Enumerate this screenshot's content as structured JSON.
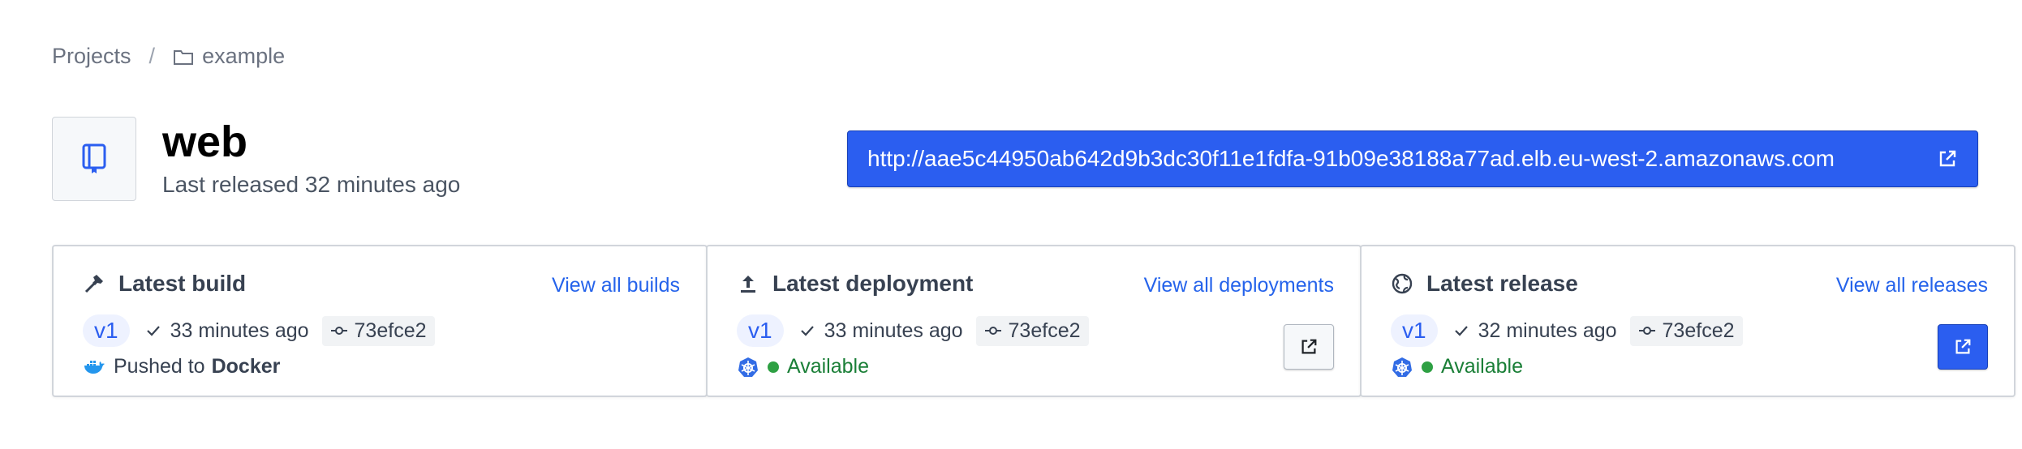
{
  "breadcrumb": {
    "root": "Projects",
    "separator": "/",
    "current": "example"
  },
  "header": {
    "title": "web",
    "subtitle": "Last released 32 minutes ago",
    "url": "http://aae5c44950ab642d9b3dc30f11e1fdfa-91b09e38188a77ad.elb.eu-west-2.amazonaws.com"
  },
  "build": {
    "title": "Latest build",
    "link": "View all builds",
    "version": "v1",
    "time": "33 minutes ago",
    "commit": "73efce2",
    "pushed_prefix": "Pushed to",
    "pushed_target": "Docker"
  },
  "deployment": {
    "title": "Latest deployment",
    "link": "View all deployments",
    "version": "v1",
    "time": "33 minutes ago",
    "commit": "73efce2",
    "status": "Available"
  },
  "release": {
    "title": "Latest release",
    "link": "View all releases",
    "version": "v1",
    "time": "32 minutes ago",
    "commit": "73efce2",
    "status": "Available"
  },
  "colors": {
    "accent": "#2b5ef0",
    "link": "#2563eb",
    "success": "#2ea043",
    "kubernetes": "#326ce5",
    "docker": "#2496ed"
  }
}
